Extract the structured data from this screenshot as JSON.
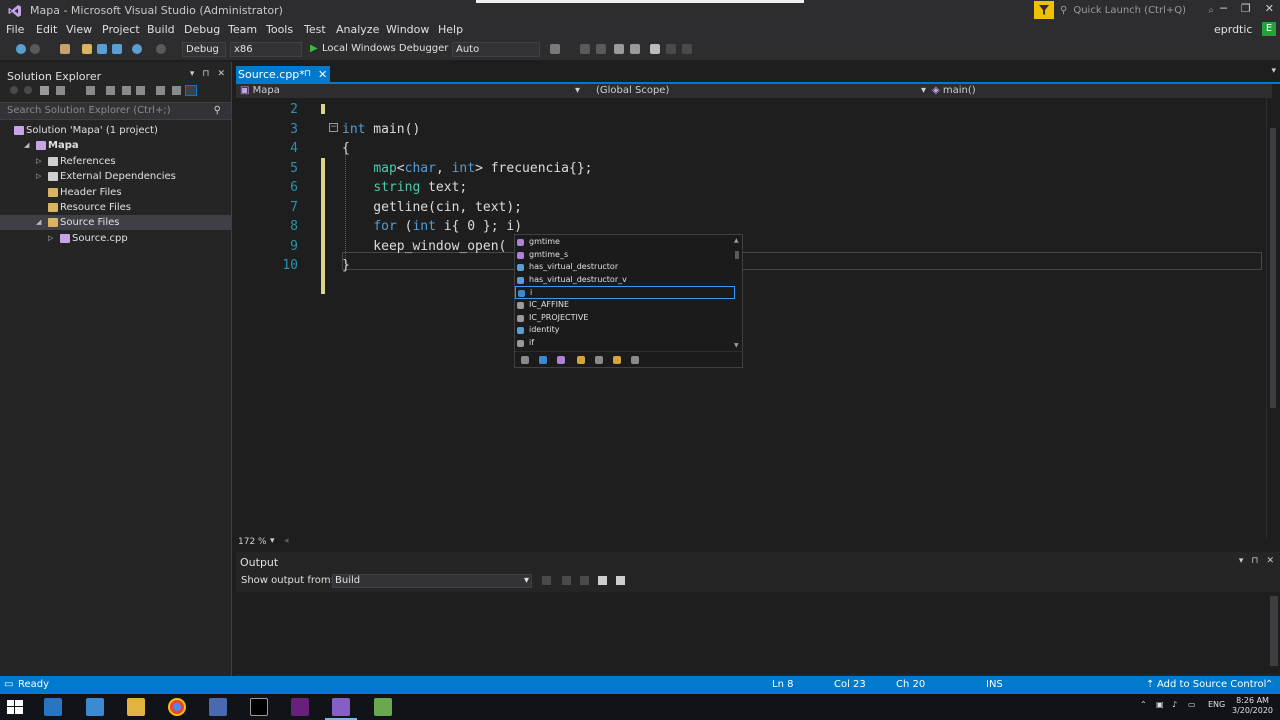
{
  "window": {
    "title": "Mapa - Microsoft Visual Studio  (Administrator)",
    "quick_launch_placeholder": "Quick Launch (Ctrl+Q)",
    "user": "eprdtic",
    "user_badge": "E"
  },
  "menu": {
    "items": [
      "File",
      "Edit",
      "View",
      "Project",
      "Build",
      "Debug",
      "Team",
      "Tools",
      "Test",
      "Analyze",
      "Window",
      "Help"
    ]
  },
  "toolbar": {
    "config": "Debug",
    "platform": "x86",
    "debugger": "Local Windows Debugger",
    "mode": "Auto"
  },
  "solution_explorer": {
    "title": "Solution Explorer",
    "search_placeholder": "Search Solution Explorer (Ctrl+;)",
    "tree": [
      {
        "label": "Solution 'Mapa' (1 project)",
        "depth": 0,
        "arrow": ""
      },
      {
        "label": "Mapa",
        "depth": 1,
        "arrow": "◢"
      },
      {
        "label": "References",
        "depth": 2,
        "arrow": "▷"
      },
      {
        "label": "External Dependencies",
        "depth": 2,
        "arrow": "▷"
      },
      {
        "label": "Header Files",
        "depth": 2,
        "arrow": ""
      },
      {
        "label": "Resource Files",
        "depth": 2,
        "arrow": ""
      },
      {
        "label": "Source Files",
        "depth": 2,
        "arrow": "◢",
        "selected": true
      },
      {
        "label": "Source.cpp",
        "depth": 3,
        "arrow": "▷"
      }
    ]
  },
  "editor": {
    "tab_label": "Source.cpp*",
    "nav_project": "Mapa",
    "nav_scope": "(Global Scope)",
    "nav_member": "main()",
    "zoom": "172 %",
    "line_numbers": [
      "2",
      "3",
      "4",
      "5",
      "6",
      "7",
      "8",
      "9",
      "10"
    ],
    "lines": [
      "",
      "int main()",
      "{",
      "    map<char, int> frecuencia{};",
      "    string text;",
      "    getline(cin, text);",
      "    for (int i{ 0 }; i)",
      "    keep_window_open(",
      "}"
    ]
  },
  "intellisense": {
    "items": [
      "gmtime",
      "gmtime_s",
      "has_virtual_destructor",
      "has_virtual_destructor_v",
      "i",
      "IC_AFFINE",
      "IC_PROJECTIVE",
      "identity",
      "if"
    ],
    "selected_index": 4
  },
  "output": {
    "title": "Output",
    "show_from_label": "Show output from:",
    "source": "Build"
  },
  "status": {
    "state": "Ready",
    "ln": "Ln 8",
    "col": "Col 23",
    "ch": "Ch 20",
    "ins": "INS",
    "source_control": "Add to Source Control"
  },
  "tray": {
    "lang": "ENG",
    "time": "8:26 AM",
    "date": "3/20/2020"
  },
  "colors": {
    "accent": "#007acc",
    "keyword": "#569cd6",
    "type": "#4ec9b0",
    "line_number": "#2b91af"
  }
}
